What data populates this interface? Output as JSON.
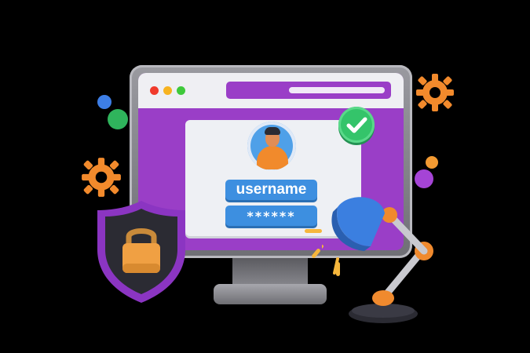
{
  "login_form": {
    "username_label": "username",
    "password_mask": "******"
  },
  "colors": {
    "screen_purple": "#9a3ec7",
    "field_blue": "#3d8fe0",
    "success_green": "#34c46a",
    "accent_orange": "#f18a2c"
  },
  "icons": [
    "check-icon",
    "padlock-icon",
    "shield-icon",
    "gear-icon",
    "user-avatar-icon",
    "desk-lamp-icon"
  ]
}
